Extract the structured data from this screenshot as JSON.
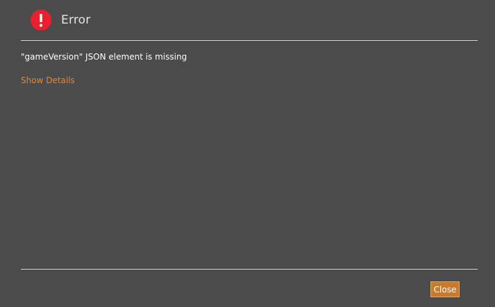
{
  "dialog": {
    "title": "Error",
    "icon": "error-exclamation-icon",
    "message": "\"gameVersion\" JSON element is missing",
    "details_link": "Show Details",
    "close_label": "Close"
  },
  "colors": {
    "background": "#4b4b4b",
    "divider": "#d6d6d6",
    "icon_red": "#e8202f",
    "link_orange": "#e0893b",
    "button_orange": "#c87b2f"
  }
}
